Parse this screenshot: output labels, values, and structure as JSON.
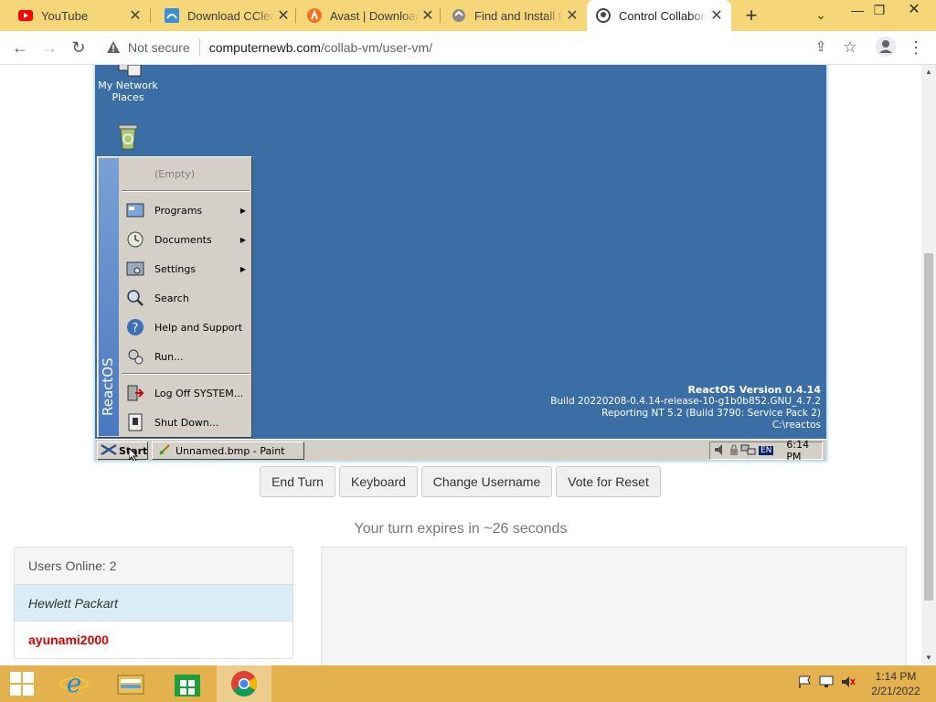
{
  "browser": {
    "tabs": [
      {
        "title": "YouTube",
        "icon": "youtube-icon"
      },
      {
        "title": "Download CCleaner",
        "icon": "ccleaner-icon"
      },
      {
        "title": "Avast | Download",
        "icon": "avast-icon"
      },
      {
        "title": "Find and Install th",
        "icon": "install-icon"
      },
      {
        "title": "Control Collabora",
        "icon": "collabvm-icon",
        "active": true
      }
    ],
    "security_label": "Not secure",
    "url_host": "computernewb.com",
    "url_path": "/collab-vm/user-vm/"
  },
  "vm": {
    "desktop_icons": [
      {
        "label": "My Network Places",
        "icon": "network-places-icon"
      },
      {
        "label": "",
        "icon": "recycle-bin-icon"
      }
    ],
    "start_menu": {
      "banner": "ReactOS",
      "items": [
        {
          "label": "(Empty)",
          "icon": "",
          "submenu": false
        },
        {
          "label": "Programs",
          "icon": "programs-icon",
          "submenu": true
        },
        {
          "label": "Documents",
          "icon": "documents-icon",
          "submenu": true
        },
        {
          "label": "Settings",
          "icon": "settings-icon",
          "submenu": true
        },
        {
          "label": "Search",
          "icon": "search-icon",
          "submenu": false
        },
        {
          "label": "Help and Support",
          "icon": "help-icon",
          "submenu": false
        },
        {
          "label": "Run...",
          "icon": "run-icon",
          "submenu": false
        },
        {
          "label": "Log Off SYSTEM...",
          "icon": "logoff-icon",
          "submenu": false
        },
        {
          "label": "Shut Down...",
          "icon": "shutdown-icon",
          "submenu": false
        }
      ]
    },
    "version": {
      "title": "ReactOS Version 0.4.14",
      "build": "Build 20220208-0.4.14-release-10-g1b0b852.GNU_4.7.2",
      "reporting": "Reporting NT 5.2 (Build 3790: Service Pack 2)",
      "path": "C:\\reactos"
    },
    "taskbar": {
      "start_label": "Start",
      "window_label": "Unnamed.bmp - Paint",
      "lang": "EN",
      "clock": "6:14 PM"
    }
  },
  "controls": {
    "end_turn": "End Turn",
    "keyboard": "Keyboard",
    "change_username": "Change Username",
    "vote_reset": "Vote for Reset"
  },
  "turn_status": "Your turn expires in ~26 seconds",
  "users": {
    "header": "Users Online: 2",
    "list": [
      "Hewlett Packart",
      "ayunami2000"
    ]
  },
  "windows_taskbar": {
    "time": "1:14 PM",
    "date": "2/21/2022",
    "colors": {
      "taskbar": "#e3b24f",
      "tabstrip": "#f5d679"
    }
  }
}
